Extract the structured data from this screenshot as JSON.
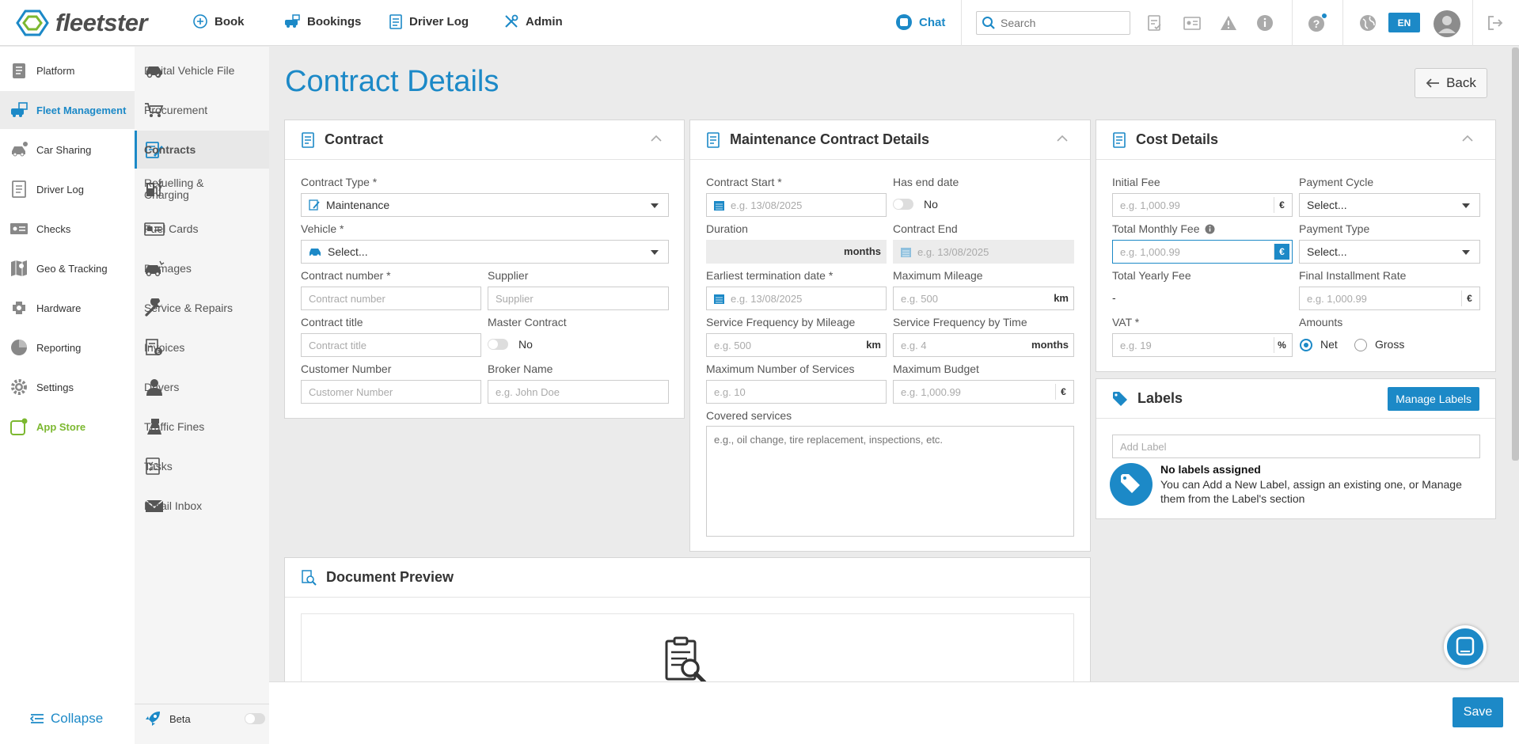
{
  "app": {
    "brand": "fleetster"
  },
  "topnav": {
    "book": "Book",
    "bookings": "Bookings",
    "driver_log": "Driver Log",
    "admin": "Admin",
    "chat": "Chat",
    "search_placeholder": "Search",
    "language": "EN"
  },
  "sidebar": {
    "items": [
      {
        "label": "Platform",
        "icon": "platform-icon"
      },
      {
        "label": "Fleet Management",
        "icon": "fleet-management-icon"
      },
      {
        "label": "Car Sharing",
        "icon": "car-sharing-icon"
      },
      {
        "label": "Driver Log",
        "icon": "driver-log-icon"
      },
      {
        "label": "Checks",
        "icon": "checks-icon"
      },
      {
        "label": "Geo & Tracking",
        "icon": "geo-tracking-icon"
      },
      {
        "label": "Hardware",
        "icon": "hardware-icon"
      },
      {
        "label": "Reporting",
        "icon": "reporting-icon"
      },
      {
        "label": "Settings",
        "icon": "settings-icon"
      },
      {
        "label": "App Store",
        "icon": "app-store-icon"
      }
    ],
    "collapse": "Collapse"
  },
  "subnav": {
    "items": [
      {
        "label": "Digital Vehicle File"
      },
      {
        "label": "Procurement"
      },
      {
        "label": "Contracts"
      },
      {
        "label": "Refuelling &",
        "label2": "Charging"
      },
      {
        "label": "Fuel Cards"
      },
      {
        "label": "Damages"
      },
      {
        "label": "Service & Repairs"
      },
      {
        "label": "Invoices"
      },
      {
        "label": "Drivers"
      },
      {
        "label": "Traffic Fines"
      },
      {
        "label": "Tasks"
      },
      {
        "label": "Email Inbox"
      }
    ],
    "beta": "Beta"
  },
  "page": {
    "title": "Contract Details",
    "back": "Back"
  },
  "contract": {
    "title": "Contract",
    "contract_type_label": "Contract Type *",
    "contract_type_value": "Maintenance",
    "vehicle_label": "Vehicle *",
    "vehicle_value": "Select...",
    "contract_number_label": "Contract number *",
    "contract_number_ph": "Contract number",
    "supplier_label": "Supplier",
    "supplier_ph": "Supplier",
    "contract_title_label": "Contract title",
    "contract_title_ph": "Contract title",
    "master_contract_label": "Master Contract",
    "master_contract_value": "No",
    "customer_number_label": "Customer Number",
    "customer_number_ph": "Customer Number",
    "broker_name_label": "Broker Name",
    "broker_name_ph": "e.g. John Doe"
  },
  "maintenance": {
    "title": "Maintenance Contract Details",
    "start_label": "Contract Start *",
    "start_ph": "e.g. 13/08/2025",
    "has_end_label": "Has end date",
    "has_end_value": "No",
    "duration_label": "Duration",
    "duration_unit": "months",
    "end_label": "Contract End",
    "end_ph": "e.g. 13/08/2025",
    "earliest_label": "Earliest termination date *",
    "earliest_ph": "e.g. 13/08/2025",
    "max_mileage_label": "Maximum Mileage",
    "max_mileage_ph": "e.g. 500",
    "max_mileage_unit": "km",
    "freq_mileage_label": "Service Frequency by Mileage",
    "freq_mileage_ph": "e.g. 500",
    "freq_mileage_unit": "km",
    "freq_time_label": "Service Frequency by Time",
    "freq_time_ph": "e.g. 4",
    "freq_time_unit": "months",
    "max_services_label": "Maximum Number of Services",
    "max_services_ph": "e.g. 10",
    "max_budget_label": "Maximum Budget",
    "max_budget_ph": "e.g. 1,000.99",
    "max_budget_unit": "€",
    "covered_label": "Covered services",
    "covered_ph": "e.g., oil change, tire replacement, inspections, etc."
  },
  "cost": {
    "title": "Cost Details",
    "initial_fee_label": "Initial Fee",
    "initial_fee_ph": "e.g. 1,000.99",
    "payment_cycle_label": "Payment Cycle",
    "payment_cycle_value": "Select...",
    "monthly_fee_label": "Total Monthly Fee",
    "monthly_fee_ph": "e.g. 1,000.99",
    "payment_type_label": "Payment Type",
    "payment_type_value": "Select...",
    "yearly_fee_label": "Total Yearly Fee",
    "yearly_fee_value": "-",
    "final_rate_label": "Final Installment Rate",
    "final_rate_ph": "e.g. 1,000.99",
    "vat_label": "VAT *",
    "vat_ph": "e.g. 19",
    "vat_unit": "%",
    "amounts_label": "Amounts",
    "net": "Net",
    "gross": "Gross",
    "currency": "€"
  },
  "labels": {
    "title": "Labels",
    "manage": "Manage Labels",
    "add_ph": "Add Label",
    "empty_title": "No labels assigned",
    "empty_text": "You can Add a New Label, assign an existing one, or Manage them from the Label's section"
  },
  "preview": {
    "title": "Document Preview"
  },
  "footer": {
    "save": "Save"
  },
  "colors": {
    "accent": "#1c89c7",
    "app_store": "#7cb830"
  }
}
